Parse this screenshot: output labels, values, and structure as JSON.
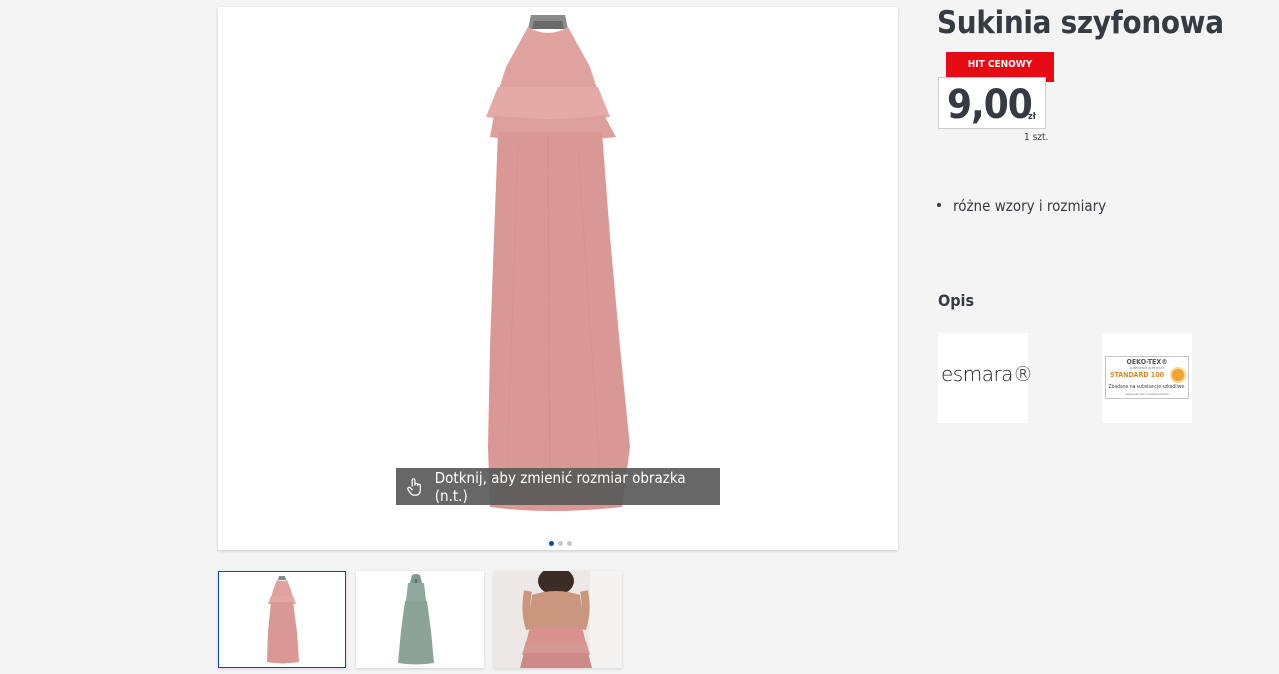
{
  "product": {
    "title": "Sukinia szyfonowa",
    "price_badge": "HIT CENOWY",
    "price_value": "9,00",
    "price_currency": "zł",
    "unit": "1 szt.",
    "features": [
      "różne wzory i rozmiary"
    ],
    "description_title": "Opis"
  },
  "gallery": {
    "zoom_hint": "Dotknij, aby zmienić rozmiar obrazka (n.t.)",
    "dots_count": 3,
    "active_dot": 0,
    "thumbnails": [
      "pink-dress",
      "green-dress",
      "pink-dress-back"
    ],
    "selected_thumbnail": 0
  },
  "logos": {
    "brand": "esmara®",
    "certification": {
      "name": "OEKO-TEX®",
      "sub": "CONFIDENCE IN TEXTILES",
      "standard": "STANDARD 100",
      "note": "Zbadane na substancje szkodliwe.",
      "url": "www.oeko-tex.com/standard100"
    }
  },
  "colors": {
    "accent_blue": "#0050aa",
    "badge_red": "#e60a14",
    "dress_pink": "#dc9b97",
    "dress_green": "#8fa89c"
  }
}
